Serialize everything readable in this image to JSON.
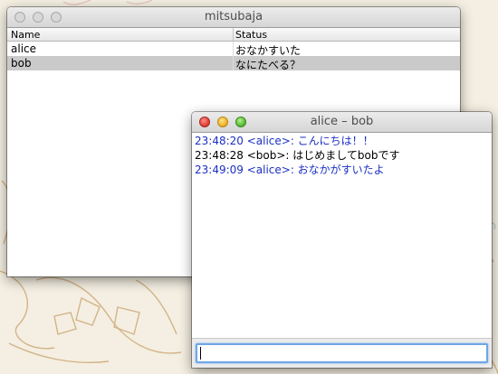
{
  "main_window": {
    "title": "mitsubaja",
    "columns": {
      "name": "Name",
      "status": "Status"
    },
    "rows": [
      {
        "name": "alice",
        "status": "おなかすいた",
        "selected": false
      },
      {
        "name": "bob",
        "status": "なにたべる？",
        "selected": true
      }
    ]
  },
  "chat_window": {
    "title": "alice – bob",
    "messages": [
      {
        "text": "23:48:20 <alice>: こんにちは！！",
        "sender": "alice"
      },
      {
        "text": "23:48:28 <bob>: はじめましてbobです",
        "sender": "bob"
      },
      {
        "text": "23:49:09 <alice>: おなかがすいたよ",
        "sender": "alice"
      }
    ],
    "input": {
      "value": "",
      "placeholder": ""
    }
  },
  "colors": {
    "alice_text": "#1b2fc4",
    "bob_text": "#000000",
    "selection": "#cacaca",
    "focus_ring": "#6ea6e6",
    "desktop_bg": "#f4efe2"
  }
}
